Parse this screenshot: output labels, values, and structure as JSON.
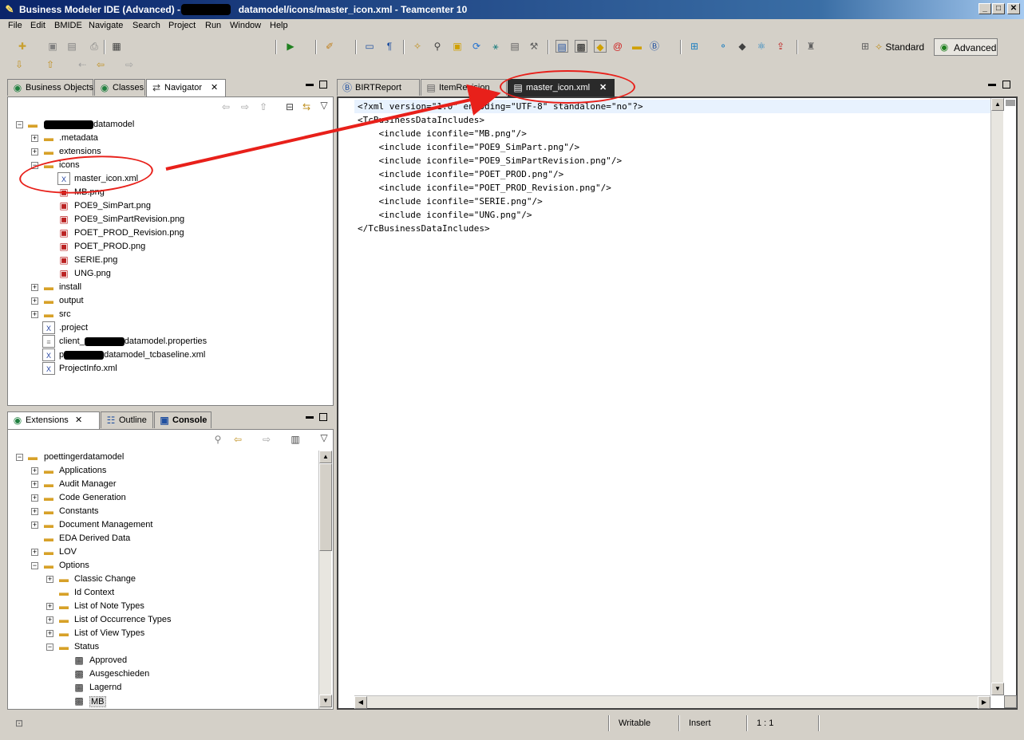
{
  "window": {
    "title_prefix": "Business Modeler IDE (Advanced) - p",
    "title_suffix": "datamodel/icons/master_icon.xml - Teamcenter 10"
  },
  "menu": [
    "File",
    "Edit",
    "BMIDE",
    "Navigate",
    "Search",
    "Project",
    "Run",
    "Window",
    "Help"
  ],
  "perspectives": {
    "standard": "Standard",
    "advanced": "Advanced"
  },
  "left_top_tabs": {
    "business_objects": "Business Objects",
    "classes": "Classes",
    "navigator": "Navigator"
  },
  "navigator_tree": {
    "project_suffix": "datamodel",
    "metadata": ".metadata",
    "extensions": "extensions",
    "icons": "icons",
    "master_icon": "master_icon.xml",
    "mb": "MB.png",
    "poe9_simpart": "POE9_SimPart.png",
    "poe9_simpartrev": "POE9_SimPartRevision.png",
    "poet_prod_rev": "POET_PROD_Revision.png",
    "poet_prod": "POET_PROD.png",
    "serie": "SERIE.png",
    "ung": "UNG.png",
    "install": "install",
    "output": "output",
    "src": "src",
    "project_file": ".project",
    "client_prefix": "client_",
    "client_suffix": "datamodel.properties",
    "baseline_prefix": "p",
    "baseline_suffix": "datamodel_tcbaseline.xml",
    "projectinfo": "ProjectInfo.xml"
  },
  "left_bottom_tabs": {
    "extensions": "Extensions",
    "outline": "Outline",
    "console": "Console"
  },
  "extensions_tree": {
    "root": "poettingerdatamodel",
    "applications": "Applications",
    "audit_manager": "Audit Manager",
    "code_generation": "Code Generation",
    "constants": "Constants",
    "document_management": "Document Management",
    "eda_derived_data": "EDA Derived Data",
    "lov": "LOV",
    "options": "Options",
    "classic_change": "Classic Change",
    "id_context": "Id Context",
    "list_note_types": "List of Note Types",
    "list_occurrence_types": "List of Occurrence Types",
    "list_view_types": "List of View Types",
    "status": "Status",
    "approved": "Approved",
    "ausgeschieden": "Ausgeschieden",
    "lagernd": "Lagernd",
    "mb": "MB"
  },
  "editor_tabs": {
    "birt": "BIRTReport",
    "itemrevision": "ItemRevision",
    "master_icon": "master_icon.xml"
  },
  "editor_lines": [
    "<?xml version=\"1.0\" encoding=\"UTF-8\" standalone=\"no\"?>",
    "<TcBusinessDataIncludes>",
    "    <include iconfile=\"MB.png\"/>",
    "    <include iconfile=\"POE9_SimPart.png\"/>",
    "    <include iconfile=\"POE9_SimPartRevision.png\"/>",
    "    <include iconfile=\"POET_PROD.png\"/>",
    "    <include iconfile=\"POET_PROD_Revision.png\"/>",
    "    <include iconfile=\"SERIE.png\"/>",
    "    <include iconfile=\"UNG.png\"/>",
    "</TcBusinessDataIncludes>"
  ],
  "status": {
    "writable": "Writable",
    "insert": "Insert",
    "position": "1 : 1"
  },
  "colors": {
    "annotation": "#e8201a",
    "titlebar": "#0a246a"
  }
}
